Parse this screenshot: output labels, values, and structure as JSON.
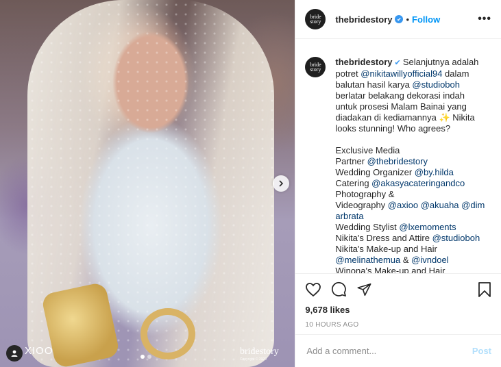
{
  "post": {
    "username": "thebridestory",
    "avatar_text": "bride story",
    "follow_label": "Follow",
    "separator": "•",
    "more_label": "•••",
    "caption_lines": [
      [
        {
          "t": "thebridestory",
          "k": "user"
        },
        {
          "t": " ✔ ",
          "k": "badge"
        },
        {
          "t": "Selanjutnya adalah",
          "k": "text"
        }
      ],
      [
        {
          "t": "potret ",
          "k": "text"
        },
        {
          "t": "@nikitawillyofficial94",
          "k": "mention"
        },
        {
          "t": " dalam",
          "k": "text"
        }
      ],
      [
        {
          "t": "balutan hasil karya ",
          "k": "text"
        },
        {
          "t": "@studioboh",
          "k": "mention"
        }
      ],
      [
        {
          "t": "berlatar belakang dekorasi indah",
          "k": "text"
        }
      ],
      [
        {
          "t": "untuk prosesi Malam Bainai yang",
          "k": "text"
        }
      ],
      [
        {
          "t": "diadakan di kediamannya ✨ Nikita",
          "k": "text"
        }
      ],
      [
        {
          "t": "looks stunning! Who agrees?",
          "k": "text"
        }
      ],
      [],
      [
        {
          "t": "Exclusive Media",
          "k": "text"
        }
      ],
      [
        {
          "t": "Partner ",
          "k": "text"
        },
        {
          "t": "@thebridestory",
          "k": "mention"
        }
      ],
      [
        {
          "t": "Wedding Organizer ",
          "k": "text"
        },
        {
          "t": "@by.hilda",
          "k": "mention"
        }
      ],
      [
        {
          "t": "Catering ",
          "k": "text"
        },
        {
          "t": "@akasyacateringandco",
          "k": "mention"
        }
      ],
      [
        {
          "t": "Photography &",
          "k": "text"
        }
      ],
      [
        {
          "t": "Videography ",
          "k": "text"
        },
        {
          "t": "@axioo",
          "k": "mention"
        },
        {
          "t": " ",
          "k": "text"
        },
        {
          "t": "@akuaha",
          "k": "mention"
        },
        {
          "t": " ",
          "k": "text"
        },
        {
          "t": "@dim",
          "k": "mention"
        }
      ],
      [
        {
          "t": "arbrata",
          "k": "mention"
        }
      ],
      [
        {
          "t": "Wedding Stylist ",
          "k": "text"
        },
        {
          "t": "@lxemoments",
          "k": "mention"
        }
      ],
      [
        {
          "t": "Nikita's Dress and Attire ",
          "k": "text"
        },
        {
          "t": "@studioboh",
          "k": "mention"
        }
      ],
      [
        {
          "t": "Nikita's Make-up and Hair",
          "k": "text"
        }
      ],
      [
        {
          "t": "@melinathemua",
          "k": "mention"
        },
        {
          "t": " & ",
          "k": "text"
        },
        {
          "t": "@ivndoel",
          "k": "mention"
        }
      ],
      [
        {
          "t": "Winona's Make-up and Hair",
          "k": "text"
        }
      ]
    ],
    "likes": "9,678 likes",
    "timestamp": "10 HOURS AGO",
    "comment_placeholder": "Add a comment...",
    "post_button": "Post"
  },
  "photo": {
    "watermark_left": "XIOO",
    "watermark_right": "bridestory",
    "watermark_right_small": "Copyright © 2020",
    "carousel_dots": 2,
    "active_dot": 0
  },
  "icons": {
    "like": "heart-icon",
    "comment": "comment-icon",
    "share": "paper-plane-icon",
    "save": "bookmark-icon",
    "next": "chevron-right-icon",
    "tag": "user-tag-icon"
  },
  "colors": {
    "accent": "#0095f6",
    "verified": "#3897f0",
    "mention": "#00376b",
    "muted": "#8e8e8e",
    "post_disabled": "#b2dffc"
  }
}
